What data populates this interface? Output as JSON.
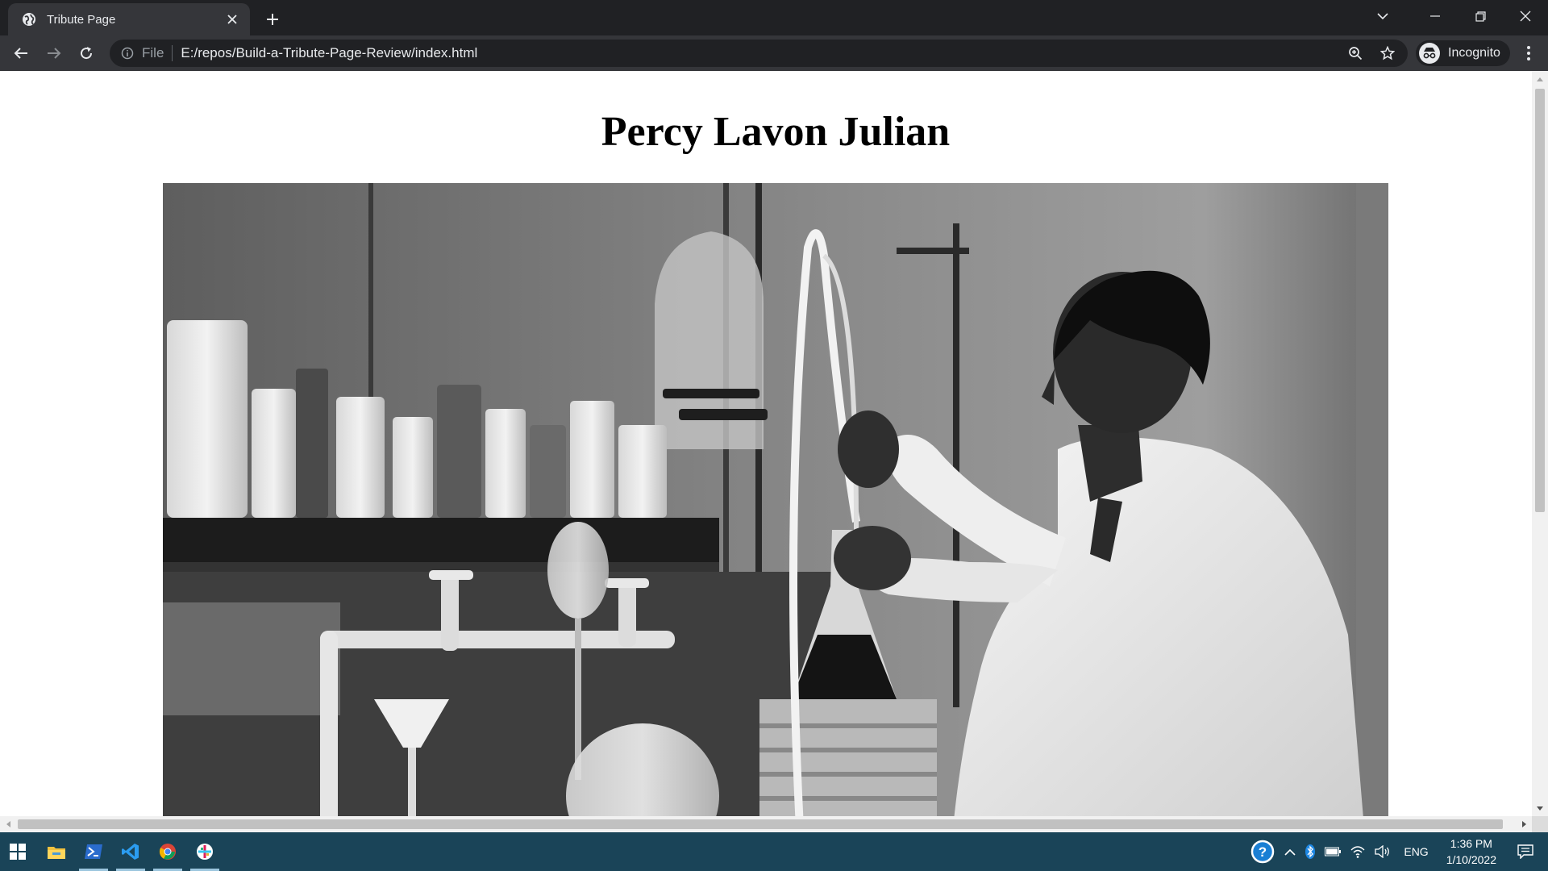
{
  "browser": {
    "tab": {
      "title": "Tribute Page"
    },
    "address": {
      "scheme": "File",
      "url": "E:/repos/Build-a-Tribute-Page-Review/index.html"
    },
    "profile": {
      "label": "Incognito"
    }
  },
  "page": {
    "title": "Percy Lavon Julian",
    "image": {
      "description_icon": "photo"
    }
  },
  "taskbar": {
    "apps": [
      "start-icon",
      "file-explorer-icon",
      "powershell-icon",
      "vscode-icon",
      "chrome-icon",
      "slack-icon"
    ],
    "language": "ENG",
    "time": "1:36 PM",
    "date": "1/10/2022"
  },
  "colors": {
    "chrome_dark": "#202124",
    "chrome_toolbar": "#35363a",
    "taskbar": "#1a4458"
  }
}
